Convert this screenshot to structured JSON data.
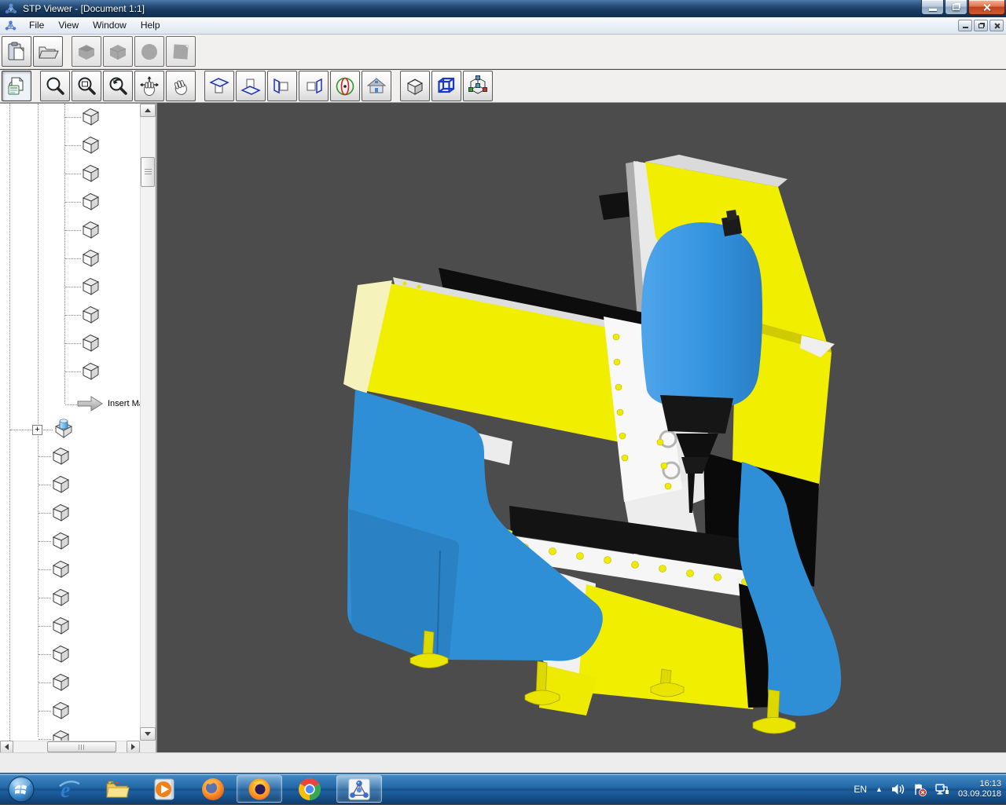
{
  "window": {
    "title": "STP Viewer - [Document 1:1]",
    "app_icon": "stp-molecule-icon",
    "controls": [
      "minimize",
      "restore",
      "close"
    ]
  },
  "menubar": {
    "items": [
      {
        "label": "File"
      },
      {
        "label": "View"
      },
      {
        "label": "Window"
      },
      {
        "label": "Help"
      }
    ],
    "mdi_controls": [
      "minimize",
      "restore",
      "close"
    ]
  },
  "toolbars": {
    "standard": {
      "buttons": [
        {
          "icon": "paste-icon",
          "enabled": true
        },
        {
          "icon": "open-folder-icon",
          "enabled": true
        },
        {
          "icon": "solid-box-icon",
          "enabled": false
        },
        {
          "icon": "cube-icon",
          "enabled": false
        },
        {
          "icon": "sphere-icon",
          "enabled": false
        },
        {
          "icon": "plane-icon",
          "enabled": false
        }
      ]
    },
    "view": {
      "buttons": [
        {
          "icon": "import-properties-icon",
          "pressed": true
        },
        {
          "icon": "zoom-icon"
        },
        {
          "icon": "zoom-window-icon"
        },
        {
          "icon": "zoom-previous-icon"
        },
        {
          "icon": "pan-icon"
        },
        {
          "icon": "rotate-icon"
        },
        {
          "icon": "view-top-icon"
        },
        {
          "icon": "view-bottom-icon"
        },
        {
          "icon": "view-left-icon"
        },
        {
          "icon": "view-right-icon"
        },
        {
          "icon": "orbit-icon"
        },
        {
          "icon": "home-view-icon"
        },
        {
          "icon": "shaded-view-icon"
        },
        {
          "icon": "wireframe-view-icon"
        },
        {
          "icon": "axonometric-view-icon"
        }
      ]
    }
  },
  "model_tree": {
    "upper_item_count": 10,
    "insert_item": {
      "label": "Insert Ma",
      "icon": "gray-arrow-icon"
    },
    "assembly_item": {
      "expander": "+",
      "icon": "open-box-part-icon"
    },
    "lower_item_count": 11
  },
  "viewport": {
    "background": "#4c4c4c",
    "model": {
      "description": "CNC milling machine 3D model",
      "colors": {
        "frame_blue": "#2f8fd6",
        "covers_yellow": "#f2ee00",
        "slides_white": "#f2f2f2",
        "spindle_black": "#141414"
      }
    }
  },
  "statusbar": {
    "text": ""
  },
  "taskbar": {
    "start": "start-orb",
    "apps": [
      {
        "icon": "internet-explorer-icon"
      },
      {
        "icon": "windows-explorer-icon"
      },
      {
        "icon": "media-player-icon"
      },
      {
        "icon": "firefox-icon"
      },
      {
        "icon": "firefox-quantum-icon",
        "boxed": true
      },
      {
        "icon": "chrome-icon"
      },
      {
        "icon": "stp-viewer-icon",
        "boxed": true,
        "active": true
      }
    ],
    "tray": {
      "language": "EN",
      "chevron": "▲",
      "icons": [
        "volume-icon",
        "action-center-flag-icon",
        "network-icon"
      ],
      "time": "16:13",
      "date": "03.09.2018"
    }
  }
}
